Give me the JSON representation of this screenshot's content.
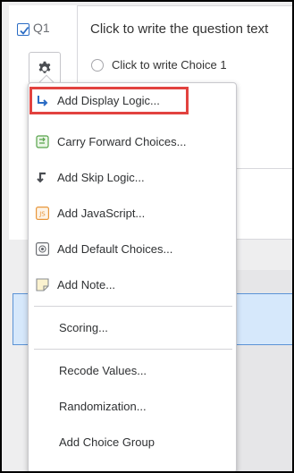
{
  "question": {
    "checkbox_checked": true,
    "label": "Q1",
    "text": "Click to write the question text",
    "choice": "Click to write Choice 1"
  },
  "menu": {
    "items": [
      {
        "label": "Add Display Logic...",
        "icon": "display-logic-icon"
      },
      {
        "label": "Carry Forward Choices...",
        "icon": "carry-forward-icon"
      },
      {
        "label": "Add Skip Logic...",
        "icon": "skip-logic-icon"
      },
      {
        "label": "Add JavaScript...",
        "icon": "javascript-icon"
      },
      {
        "label": "Add Default Choices...",
        "icon": "default-choices-icon"
      },
      {
        "label": "Add Note...",
        "icon": "note-icon"
      },
      {
        "label": "Scoring..."
      },
      {
        "label": "Recode Values..."
      },
      {
        "label": "Randomization..."
      },
      {
        "label": "Add Choice Group"
      }
    ],
    "js_badge": "JS"
  },
  "colors": {
    "accent_blue": "#2b6cc4",
    "highlight_red": "#e2423f",
    "green_icon": "#57a44b",
    "orange_icon": "#e8963a"
  }
}
